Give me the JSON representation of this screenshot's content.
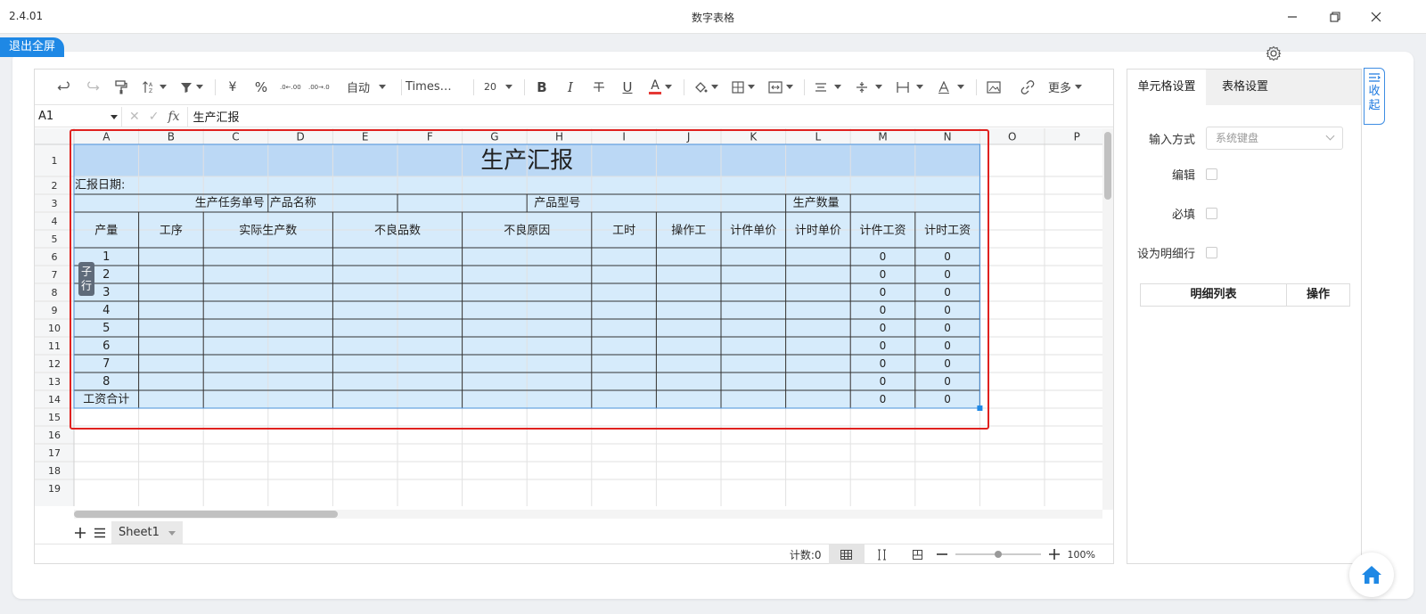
{
  "window": {
    "version": "2.4.01",
    "title": "数字表格"
  },
  "exit_fullscreen_label": "退出全屏",
  "toolbar": {
    "auto_label": "自动",
    "font_name": "Times…",
    "font_size": "20",
    "more_label": "更多",
    "currency_symbol": "¥",
    "percent_symbol": "%",
    "dec_increase": ".0←.00",
    "dec_decrease": ".00→.0",
    "bold": "B",
    "italic": "I",
    "underline": "U",
    "font_color_glyph": "A",
    "font_color": "#e53935",
    "icons": [
      "undo-icon",
      "redo-icon",
      "format-painter-icon",
      "sort-icon",
      "filter-icon",
      "currency-icon",
      "percent-icon",
      "decimal-increase-icon",
      "decimal-decrease-icon",
      "bold-icon",
      "italic-icon",
      "strikethrough-icon",
      "underline-icon",
      "font-color-icon",
      "fill-color-icon",
      "border-icon",
      "merge-cells-icon",
      "align-horizontal-icon",
      "align-vertical-icon",
      "text-wrap-icon",
      "text-rotate-icon",
      "image-icon",
      "link-icon"
    ]
  },
  "formula_bar": {
    "cell_ref": "A1",
    "fx_label": "fx",
    "content": "生产汇报"
  },
  "grid": {
    "columns": [
      "A",
      "B",
      "C",
      "D",
      "E",
      "F",
      "G",
      "H",
      "I",
      "J",
      "K",
      "L",
      "M",
      "N",
      "O",
      "P"
    ],
    "rows": [
      "1",
      "2",
      "3",
      "4",
      "5",
      "6",
      "7",
      "8",
      "9",
      "10",
      "11",
      "12",
      "13",
      "14",
      "15",
      "16",
      "17",
      "18",
      "19"
    ],
    "title": "生产汇报",
    "report_date_label": "汇报日期:",
    "row3": {
      "task_no_label": "生产任务单号",
      "product_name_label": "产品名称",
      "product_model_label": "产品型号",
      "production_qty_label": "生产数量"
    },
    "headers": [
      "产量",
      "工序",
      "实际生产数",
      "不良品数",
      "不良原因",
      "工时",
      "操作工",
      "计件单价",
      "计时单价",
      "计件工资",
      "计时工资"
    ],
    "detail_rows": [
      "1",
      "2",
      "3",
      "4",
      "5",
      "6",
      "7",
      "8"
    ],
    "zero_value": "0",
    "total_label": "工资合计",
    "row_marker": "子行",
    "highlight_color": "#d6ebfb",
    "title_bg": "#bbd8f5",
    "selection_border": "#e0211f"
  },
  "sheet_tabs": {
    "active": "Sheet1",
    "add_icon": "plus-icon",
    "list_icon": "list-icon"
  },
  "status_bar": {
    "count_label": "计数:0",
    "zoom": "100%"
  },
  "right_panel": {
    "tabs": [
      "单元格设置",
      "表格设置"
    ],
    "input_method_label": "输入方式",
    "input_method_value": "系统键盘",
    "edit_label": "编辑",
    "required_label": "必填",
    "detail_row_label": "设为明细行",
    "detail_list_header": "明细列表",
    "action_header": "操作"
  },
  "collapse_label": "收起",
  "accent_color": "#1e88e5"
}
